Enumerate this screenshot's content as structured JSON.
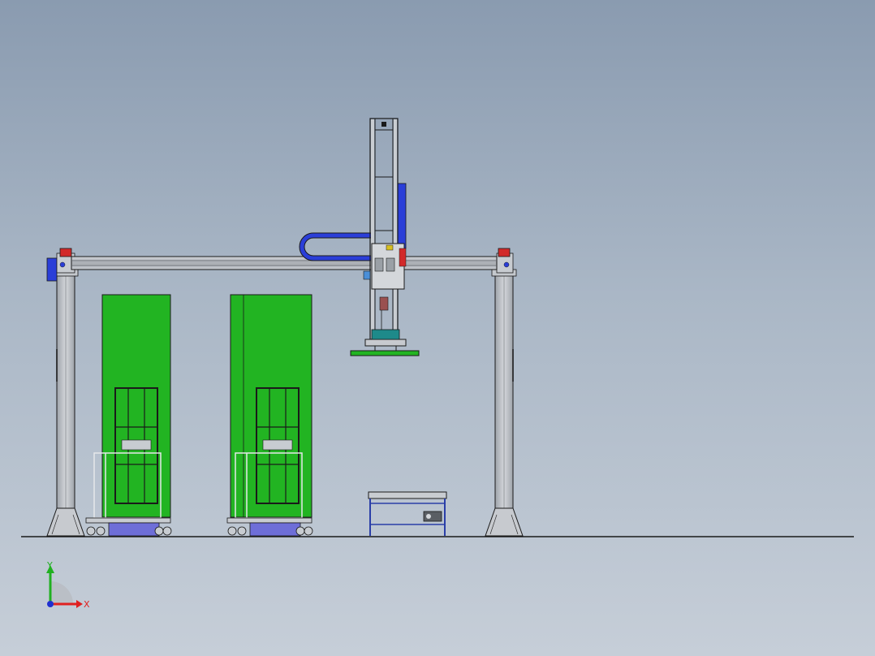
{
  "triad": {
    "x_label": "X",
    "y_label": "Y",
    "x_color": "#e02020",
    "y_color": "#20b020",
    "z_color": "#2030d0"
  },
  "colors": {
    "background_top": "#8a9bb0",
    "background_bottom": "#c6ced8",
    "machine_panel": "#22b422",
    "gantry_steel": "#b8bcc2",
    "cable_carrier": "#2a3ed8",
    "pallet_base": "#6e6ed8",
    "outline": "#1a1a1a"
  }
}
